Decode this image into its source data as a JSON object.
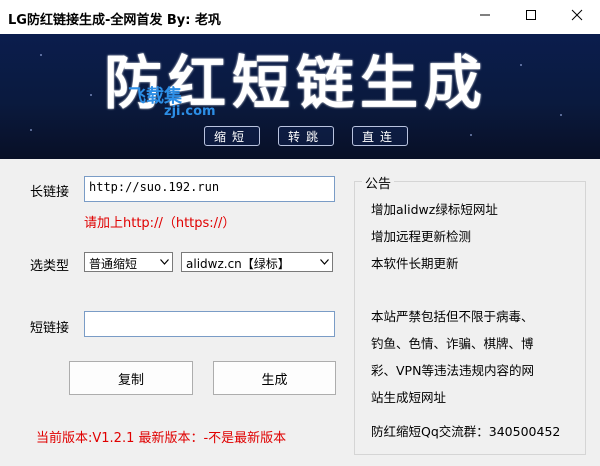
{
  "window": {
    "title": "LG防红链接生成-全网首发  By: 老巩"
  },
  "banner": {
    "title": "防红短链生成",
    "buttons": [
      "缩短",
      "转跳",
      "直连"
    ],
    "watermark_line1": "飞载集",
    "watermark_line2": "zji.com"
  },
  "form": {
    "long_link_label": "长链接",
    "long_link_value": "http://suo.192.run",
    "hint": "请加上http://（https://）",
    "type_label": "选类型",
    "type_selected": "普通缩短",
    "domain_selected": "alidwz.cn【绿标】",
    "short_link_label": "短链接",
    "short_link_value": "",
    "copy_button": "复制",
    "generate_button": "生成"
  },
  "notice": {
    "title": "公告",
    "lines": [
      "增加alidwz绿标短网址",
      "增加远程更新检测",
      "本软件长期更新",
      "本站严禁包括但不限于病毒、",
      "钓鱼、色情、诈骗、棋牌、博",
      "彩、VPN等违法违规内容的网",
      "站生成短网址",
      "防红缩短Qq交流群：340500452"
    ]
  },
  "status": {
    "version_text": "当前版本:V1.2.1  最新版本：-不是最新版本"
  },
  "colors": {
    "accent_red": "#e00000",
    "banner_bg": "#0b1d4d"
  }
}
